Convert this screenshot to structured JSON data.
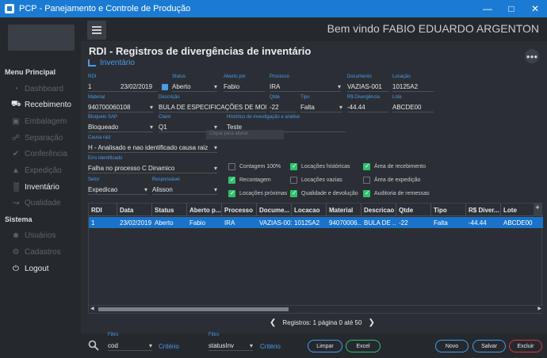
{
  "window": {
    "title": "PCP - Panejamento e Controle de Produção"
  },
  "header": {
    "welcome": "Bem vindo FABIO EDUARDO ARGENTON"
  },
  "sidebar": {
    "section_main": "Menu Principal",
    "items": [
      {
        "label": "Dashboard",
        "icon": "dashboard-icon",
        "active": false
      },
      {
        "label": "Recebimento",
        "icon": "truck-icon",
        "active": true
      },
      {
        "label": "Embalagem",
        "icon": "box-icon",
        "active": false
      },
      {
        "label": "Separação",
        "icon": "cart-icon",
        "active": false
      },
      {
        "label": "Conferência",
        "icon": "check-icon",
        "active": false
      },
      {
        "label": "Expedição",
        "icon": "shipping-icon",
        "active": false
      },
      {
        "label": "Inventário",
        "icon": "chart-icon",
        "active": true
      },
      {
        "label": "Qualidade",
        "icon": "line-chart-icon",
        "active": false
      }
    ],
    "section_system": "Sistema",
    "system_items": [
      {
        "label": "Usuários",
        "icon": "users-icon",
        "active": false
      },
      {
        "label": "Cadastros",
        "icon": "gear-icon",
        "active": false
      },
      {
        "label": "Logout",
        "icon": "power-icon",
        "active": true
      }
    ]
  },
  "page": {
    "title": "RDI - Registros de divergências de inventário",
    "subtitle": "Inventário"
  },
  "form": {
    "rdi": {
      "label": "RDI",
      "value": "1"
    },
    "data": {
      "value": "23/02/2019"
    },
    "status": {
      "label": "Status",
      "value": "Aberto"
    },
    "aberto_por": {
      "label": "Aberto por",
      "value": "Fabio"
    },
    "processo": {
      "label": "Processo",
      "value": "IRA"
    },
    "documento": {
      "label": "Documento",
      "value": "VAZIAS-001"
    },
    "locacao": {
      "label": "Locação",
      "value": "10125A2"
    },
    "material": {
      "label": "Material",
      "value": "940700060108"
    },
    "descricao": {
      "label": "Descrição",
      "value": "BULA DE ESPECIFICAÇÕES DE MONTAG"
    },
    "qtde": {
      "label": "Qtde",
      "value": "-22"
    },
    "tipo": {
      "label": "Tipo",
      "value": "Falta"
    },
    "rs_divergencia": {
      "label": "R$ Divergência",
      "value": "-44.44"
    },
    "lote": {
      "label": "Lote",
      "value": "ABCDE00"
    },
    "bloqueio_sap": {
      "label": "Bloqueio SAP",
      "value": "Bloqueado"
    },
    "claim": {
      "label": "Claim",
      "value": "Q1"
    },
    "historico": {
      "label": "Histórico de investigação e análise",
      "value": "Teste"
    },
    "tooltip": "Clique para alterar",
    "causa_raiz": {
      "label": "Causa raiz",
      "value": "H - Analisado e nao identificado causa raiz"
    },
    "erro_identificado": {
      "label": "Erro identificado",
      "value": "Falha no processo C Dinamico"
    },
    "setor": {
      "label": "Setor",
      "value": "Expedicao"
    },
    "responsavel": {
      "label": "Responsável",
      "value": "Alisson"
    },
    "checks": [
      {
        "label": "Contagem 100%",
        "checked": false
      },
      {
        "label": "Locações históricas",
        "checked": true
      },
      {
        "label": "Área de recebimento",
        "checked": true
      },
      {
        "label": "Recontagem",
        "checked": true
      },
      {
        "label": "Locações vazias",
        "checked": false
      },
      {
        "label": "Área de expedição",
        "checked": false
      },
      {
        "label": "Locações próximas",
        "checked": true
      },
      {
        "label": "Qualidade e devolução",
        "checked": true
      },
      {
        "label": "Auditoria de remessas",
        "checked": true
      }
    ]
  },
  "table": {
    "columns": [
      "RDI",
      "Data",
      "Status",
      "Aberto p...",
      "Processo",
      "Docume...",
      "Locacao",
      "Material",
      "Descricao",
      "Qtde",
      "Tipo",
      "R$ Diver...",
      "Lote"
    ],
    "rows": [
      [
        "1",
        "23/02/2019",
        "Aberto",
        "Fabio",
        "IRA",
        "VAZIAS-001",
        "10125A2",
        "94070006...",
        "BULA DE ...",
        "-22",
        "Falta",
        "-44.44",
        "ABCDE00"
      ]
    ],
    "scroll_plus": "+"
  },
  "pager": {
    "text": "Registros: 1   página 0 até 50",
    "prev": "❮",
    "next": "❯"
  },
  "footer": {
    "filter1": {
      "label": "Filtro",
      "value": "cod",
      "criterio": "Critério"
    },
    "filter2": {
      "label": "Filtro",
      "value": "statusInv",
      "criterio": "Critério"
    },
    "buttons": {
      "limpar": "Limpar",
      "excel": "Excel",
      "novo": "Novo",
      "salvar": "Salvar",
      "excluir": "Excluir"
    }
  },
  "colors": {
    "accent": "#1b7ad4",
    "label_blue": "#4a9ae8",
    "check_green": "#2ec26b",
    "delete_red": "#d9373d"
  }
}
